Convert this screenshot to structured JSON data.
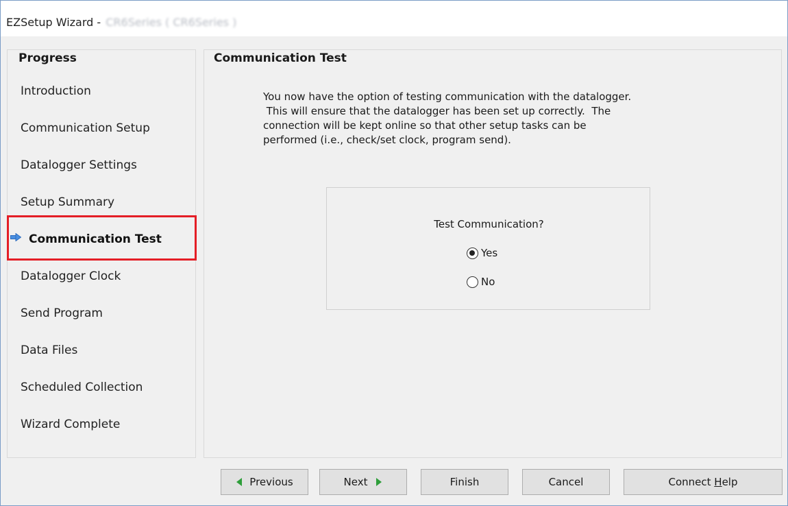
{
  "window": {
    "title": "EZSetup Wizard - ",
    "title_obscured": "CR6Series ( CR6Series )"
  },
  "progress": {
    "heading": "Progress",
    "steps": [
      {
        "label": "Introduction",
        "active": false
      },
      {
        "label": "Communication Setup",
        "active": false
      },
      {
        "label": "Datalogger Settings",
        "active": false
      },
      {
        "label": "Setup Summary",
        "active": false
      },
      {
        "label": "Communication Test",
        "active": true
      },
      {
        "label": "Datalogger Clock",
        "active": false
      },
      {
        "label": "Send Program",
        "active": false
      },
      {
        "label": "Data Files",
        "active": false
      },
      {
        "label": "Scheduled Collection",
        "active": false
      },
      {
        "label": "Wizard Complete",
        "active": false
      }
    ],
    "highlight_color": "#e41e26",
    "arrow_icon": "right-arrow-icon"
  },
  "content": {
    "heading": "Communication Test",
    "description_lines": [
      "You now have the option of testing communication with the datalogger.",
      " This will ensure that the datalogger has been set up correctly.  The",
      "connection will be kept online so that other setup tasks can be",
      "performed (i.e., check/set clock, program send)."
    ],
    "question": "Test Communication?",
    "options": [
      {
        "label": "Yes",
        "selected": true
      },
      {
        "label": "No",
        "selected": false
      }
    ]
  },
  "buttons": {
    "previous": "Previous",
    "next": "Next",
    "finish": "Finish",
    "cancel": "Cancel",
    "connect_help_prefix": "Connect ",
    "connect_help_underlined": "H",
    "connect_help_suffix": "elp",
    "arrow_color": "#2e9e3a"
  }
}
